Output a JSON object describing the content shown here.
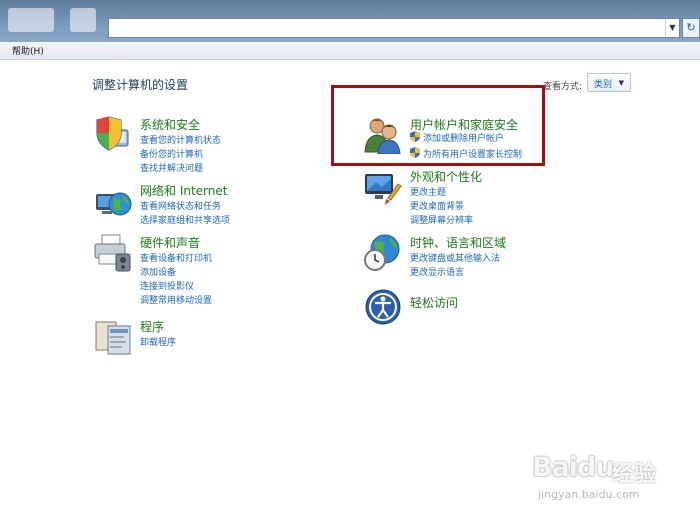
{
  "menubar": {
    "help": "帮助(H)"
  },
  "page": {
    "title": "调整计算机的设置",
    "view_label": "查看方式:",
    "view_value": "类别"
  },
  "categories": {
    "system_security": {
      "icon": "shield-computer-icon",
      "title": "系统和安全",
      "links": [
        "查看您的计算机状态",
        "备份您的计算机",
        "查找并解决问题"
      ]
    },
    "network": {
      "icon": "network-globe-icon",
      "title": "网络和 Internet",
      "links": [
        "查看网络状态和任务",
        "选择家庭组和共享选项"
      ]
    },
    "hardware": {
      "icon": "printer-icon",
      "title": "硬件和声音",
      "links": [
        "查看设备和打印机",
        "添加设备",
        "连接到投影仪",
        "调整常用移动设置"
      ]
    },
    "programs": {
      "icon": "programs-icon",
      "title": "程序",
      "links": [
        "卸载程序"
      ]
    },
    "user_accounts": {
      "icon": "users-icon",
      "title": "用户帐户和家庭安全",
      "links": [
        "添加或删除用户帐户",
        "为所有用户设置家长控制"
      ]
    },
    "appearance": {
      "icon": "display-paint-icon",
      "title": "外观和个性化",
      "links": [
        "更改主题",
        "更改桌面背景",
        "调整屏幕分辨率"
      ]
    },
    "clock": {
      "icon": "clock-globe-icon",
      "title": "时钟、语言和区域",
      "links": [
        "更改键盘或其他输入法",
        "更改显示语言"
      ]
    },
    "ease": {
      "icon": "ease-of-access-icon",
      "title": "轻松访问",
      "links": []
    }
  },
  "watermark": {
    "brand": "Baidu",
    "product": "经验",
    "url": "jingyan.baidu.com"
  },
  "colors": {
    "highlight": "#a50f14",
    "category_title": "#1c7a1c",
    "link": "#1e66b8"
  }
}
